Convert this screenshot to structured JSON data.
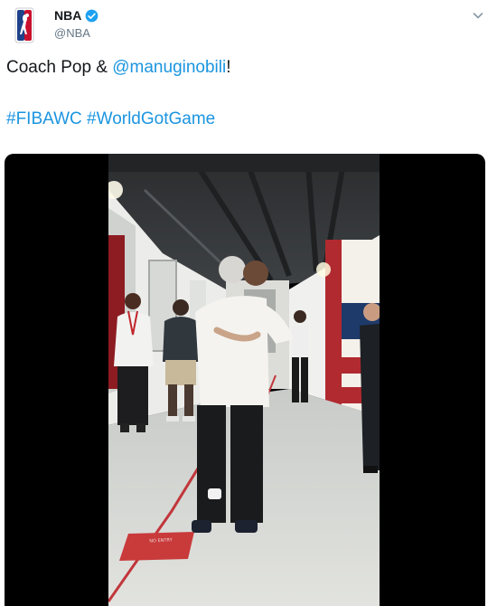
{
  "tweet": {
    "display_name": "NBA",
    "handle": "@NBA",
    "verified": true,
    "text_prefix": "Coach Pop & ",
    "mention": "@manuginobili",
    "text_suffix": "!",
    "hashtags": [
      "#FIBAWC",
      "#WorldGotGame"
    ]
  },
  "media": {
    "type": "video",
    "floor_sign": "NO ENTRY"
  },
  "colors": {
    "link": "#1b95e0",
    "verified": "#1da1f2",
    "nba_blue": "#1d428a",
    "nba_red": "#c8102e",
    "video_background": "#000000"
  },
  "icons": [
    "nba-logo-icon",
    "verified-badge-icon",
    "chevron-down-icon"
  ]
}
